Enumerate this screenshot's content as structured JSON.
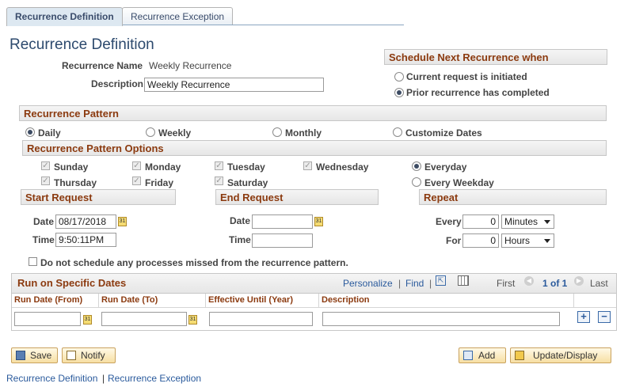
{
  "tabs": [
    {
      "label": "Recurrence Definition",
      "active": true
    },
    {
      "label": "Recurrence Exception",
      "active": false
    }
  ],
  "page_title": "Recurrence Definition",
  "recurrence_name": {
    "label": "Recurrence Name",
    "value": "Weekly Recurrence"
  },
  "description": {
    "label": "Description",
    "value": "Weekly Recurrence"
  },
  "schedule_next": {
    "header": "Schedule Next Recurrence when",
    "options": [
      {
        "label": "Current request is initiated",
        "selected": false
      },
      {
        "label": "Prior recurrence has completed",
        "selected": true
      }
    ]
  },
  "pattern": {
    "header": "Recurrence Pattern",
    "options": [
      {
        "label": "Daily",
        "selected": true
      },
      {
        "label": "Weekly",
        "selected": false
      },
      {
        "label": "Monthly",
        "selected": false
      },
      {
        "label": "Customize Dates",
        "selected": false
      }
    ]
  },
  "pattern_options": {
    "header": "Recurrence Pattern Options",
    "days": [
      {
        "label": "Sunday",
        "checked": true
      },
      {
        "label": "Monday",
        "checked": true
      },
      {
        "label": "Tuesday",
        "checked": true
      },
      {
        "label": "Wednesday",
        "checked": true
      },
      {
        "label": "Thursday",
        "checked": true
      },
      {
        "label": "Friday",
        "checked": true
      },
      {
        "label": "Saturday",
        "checked": true
      }
    ],
    "modes": [
      {
        "label": "Everyday",
        "selected": true
      },
      {
        "label": "Every Weekday",
        "selected": false
      }
    ]
  },
  "start_request": {
    "header": "Start Request",
    "date_label": "Date",
    "date_value": "08/17/2018",
    "time_label": "Time",
    "time_value": "9:50:11PM"
  },
  "end_request": {
    "header": "End Request",
    "date_label": "Date",
    "date_value": "",
    "time_label": "Time",
    "time_value": ""
  },
  "repeat": {
    "header": "Repeat",
    "every_label": "Every",
    "every_value": "0",
    "every_unit": "Minutes",
    "for_label": "For",
    "for_value": "0",
    "for_unit": "Hours"
  },
  "missed_checkbox": {
    "label": "Do not schedule any processes missed from the recurrence pattern.",
    "checked": false
  },
  "specific_dates": {
    "header": "Run on Specific Dates",
    "personalize": "Personalize",
    "find": "Find",
    "first": "First",
    "range": "1 of 1",
    "last": "Last",
    "columns": [
      "Run Date (From)",
      "Run Date (To)",
      "Effective Until (Year)",
      "Description"
    ],
    "rows": [
      {
        "from": "",
        "to": "",
        "until": "",
        "description": ""
      }
    ]
  },
  "buttons": {
    "save": "Save",
    "notify": "Notify",
    "add": "Add",
    "update": "Update/Display"
  },
  "footer_links": {
    "definition": "Recurrence Definition",
    "separator": "|",
    "exception": "Recurrence Exception"
  },
  "colors": {
    "section_text": "#8b3a0f",
    "link": "#2a5a9c",
    "title": "#2d4a6e"
  }
}
